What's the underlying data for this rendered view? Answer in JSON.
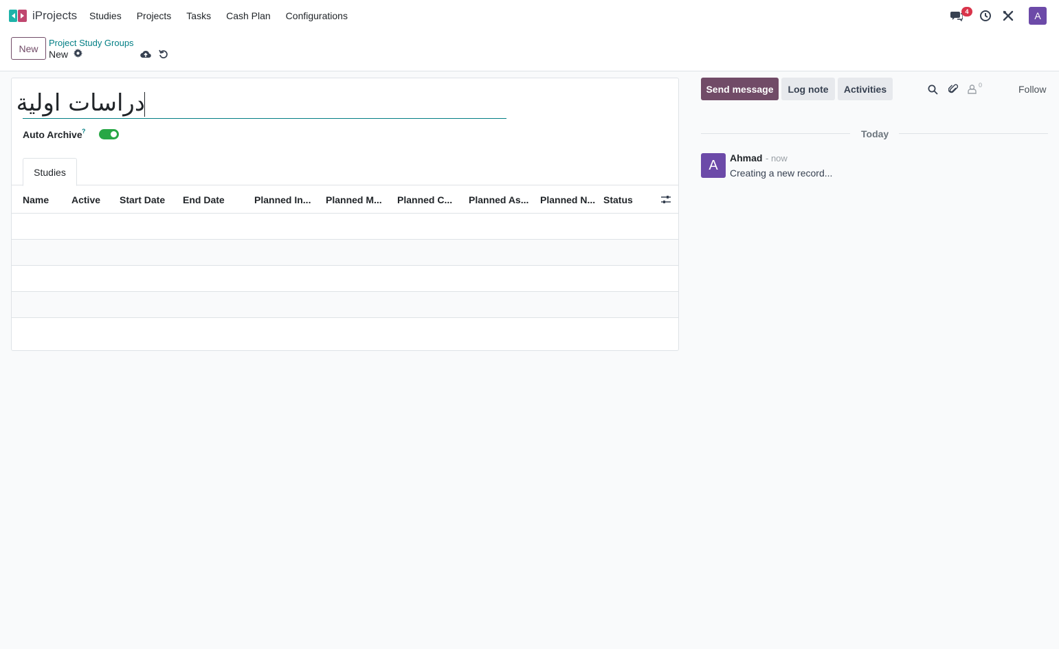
{
  "app": {
    "name": "iProjects"
  },
  "menu": {
    "items": [
      "Studies",
      "Projects",
      "Tasks",
      "Cash Plan",
      "Configurations"
    ]
  },
  "navbar": {
    "messages_badge": "4",
    "user_initial": "A"
  },
  "control_panel": {
    "new_button": "New",
    "breadcrumb": "Project Study Groups",
    "record_name": "New"
  },
  "form": {
    "title_value": "دراسات اولية",
    "auto_archive_label": "Auto Archive",
    "auto_archive_help": "?",
    "auto_archive_on": true,
    "tab_label": "Studies",
    "columns": [
      "Name",
      "Active",
      "Start Date",
      "End Date",
      "Planned In...",
      "Planned M...",
      "Planned C...",
      "Planned As...",
      "Planned N...",
      "Status"
    ]
  },
  "chatter": {
    "send_message": "Send message",
    "log_note": "Log note",
    "activities": "Activities",
    "follower_count": "0",
    "follow": "Follow",
    "date_separator": "Today",
    "message": {
      "avatar_initial": "A",
      "author": "Ahmad",
      "time": "- now",
      "body": "Creating a new record..."
    }
  },
  "colors": {
    "brand": "#714b67",
    "link": "#017e84",
    "toggle_on": "#28a745",
    "badge": "#d9344a",
    "avatar": "#6c4aa8"
  }
}
